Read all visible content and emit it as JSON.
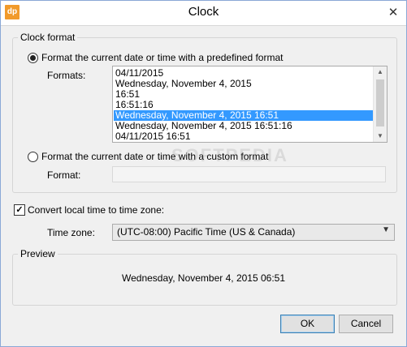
{
  "window": {
    "title": "Clock",
    "app_icon_text": "dp",
    "close_glyph": "✕"
  },
  "clock_format": {
    "group_title": "Clock format",
    "predefined_label": "Format the current date or time with a predefined format",
    "formats_label": "Formats:",
    "formats": [
      "04/11/2015",
      "Wednesday, November 4, 2015",
      "16:51",
      "16:51:16",
      "Wednesday, November 4, 2015 16:51",
      "Wednesday, November 4, 2015 16:51:16",
      "04/11/2015 16:51"
    ],
    "selected_index": 4,
    "custom_label": "Format the current date or time with a custom format",
    "format_label": "Format:",
    "format_value": ""
  },
  "timezone": {
    "convert_label": "Convert local time to time zone:",
    "checked": true,
    "zone_label": "Time zone:",
    "zone_value": "(UTC-08:00) Pacific Time (US & Canada)"
  },
  "preview": {
    "group_title": "Preview",
    "text": "Wednesday, November 4, 2015 06:51"
  },
  "buttons": {
    "ok": "OK",
    "cancel": "Cancel"
  },
  "watermark": "SOFTPEDIA"
}
